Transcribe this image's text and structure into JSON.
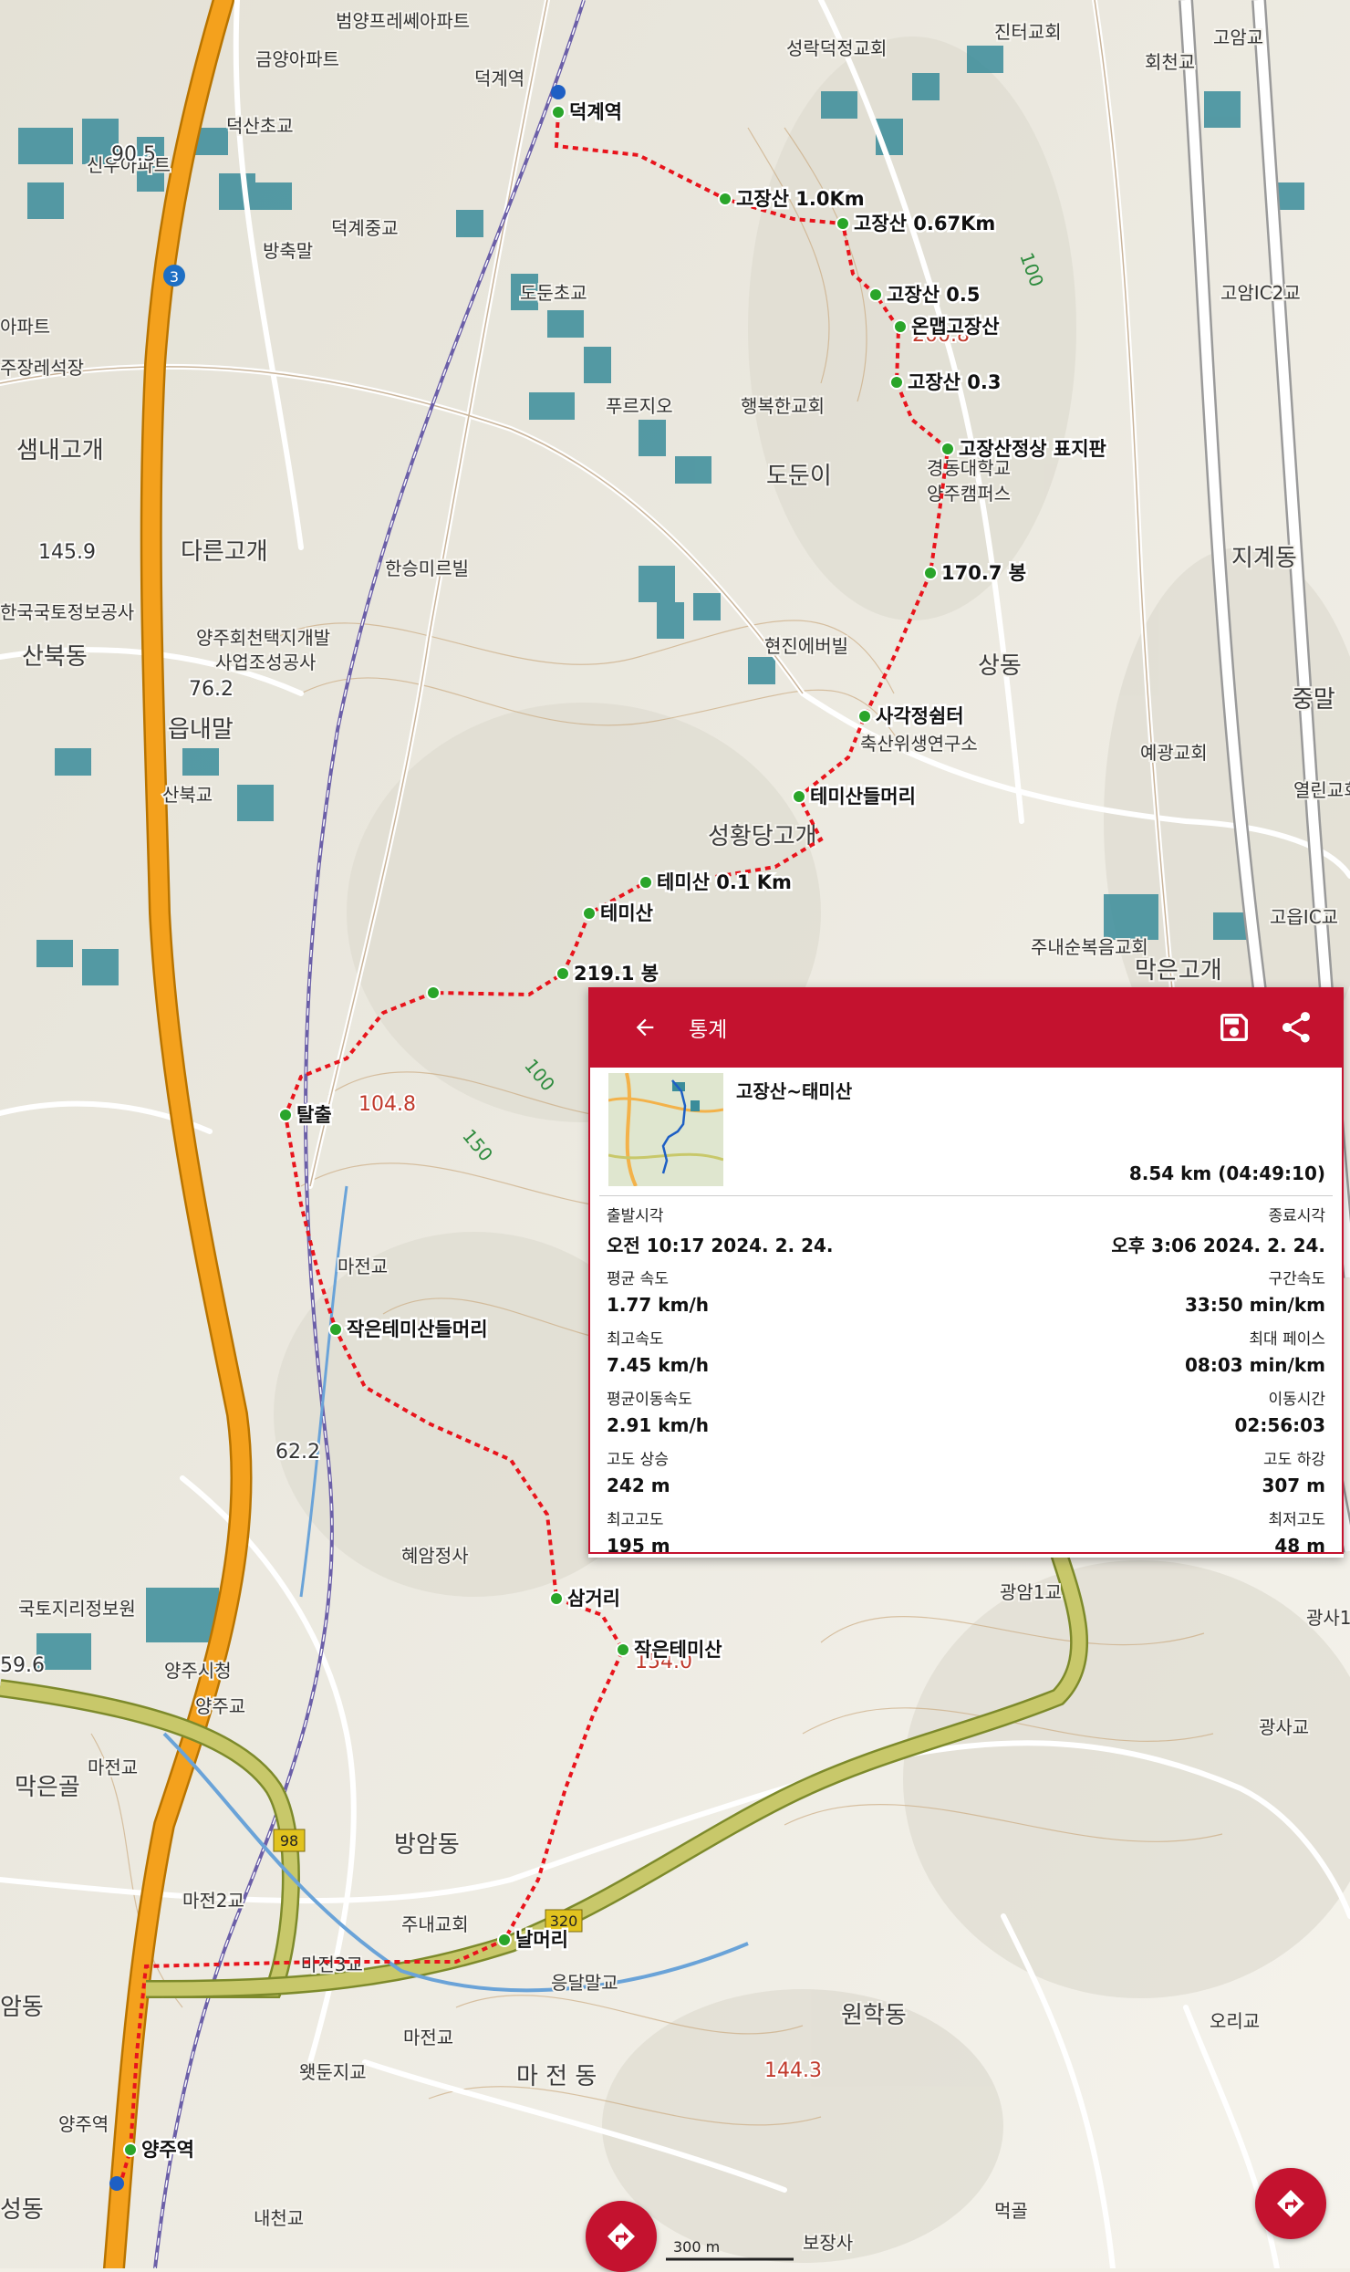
{
  "map": {
    "waypoints": [
      {
        "name": "덕계역"
      },
      {
        "name": "고장산 1.0Km"
      },
      {
        "name": "고장산 0.67Km"
      },
      {
        "name": "고장산 0.5"
      },
      {
        "name": "온맵고장산"
      },
      {
        "name": "고장산 0.3"
      },
      {
        "name": "고장산정상 표지판"
      },
      {
        "name": "170.7 봉"
      },
      {
        "name": "사각정쉼터"
      },
      {
        "name": "테미산들머리"
      },
      {
        "name": "테미산 0.1 Km"
      },
      {
        "name": "테미산"
      },
      {
        "name": "219.1 봉"
      },
      {
        "name": ""
      },
      {
        "name": "탈출"
      },
      {
        "name": "작은테미산들머리"
      },
      {
        "name": "삼거리"
      },
      {
        "name": "작은테미산"
      },
      {
        "name": "날머리"
      },
      {
        "name": "양주역"
      }
    ],
    "places": [
      "범양프레쎄아파트",
      "덕계역",
      "성락덕정교회",
      "진터교회",
      "회천교",
      "고암교",
      "금양아파트",
      "덕산초교",
      "신우아파트",
      "덕계중교",
      "방축말",
      "도둔초교",
      "아파트",
      "주장레석장",
      "샘내고개",
      "다른고개",
      "푸르지오",
      "행복한교회",
      "도둔이",
      "경동대학교",
      "양주캠퍼스",
      "지계동",
      "한승미르빌",
      "한국국토정보공사",
      "양주회천택지개발",
      "사업조성공사",
      "산북동",
      "읍내말",
      "현진에버빌",
      "상동",
      "축산위생연구소",
      "중말",
      "예광교회",
      "산북교",
      "성황당고개",
      "열린교회",
      "고읍IC교",
      "주내순복음교회",
      "막은고개",
      "마전교",
      "혜암정사",
      "국토지리정보원",
      "양주시청",
      "양주교",
      "막은골",
      "마전교",
      "방암동",
      "마전2교",
      "주내교회",
      "마전3교",
      "응달말교",
      "원학동",
      "오리교",
      "암동",
      "마전교",
      "왯둔지교",
      "마 전 동",
      "양주역",
      "성동",
      "내천교",
      "보장사",
      "먹골",
      "광암1교",
      "광사1",
      "광사교",
      "고암IC2교",
      "고읍IC교"
    ],
    "elevations": [
      "200.8",
      "104.8",
      "62.2",
      "76.2",
      "145.9",
      "154.0",
      "144.3",
      "90.5",
      "59.6"
    ],
    "contours": [
      "100",
      "150",
      "100"
    ],
    "road_numbers": [
      "3",
      "98",
      "320"
    ],
    "scale_label": "300 m",
    "route_color": "#e8141c",
    "waypoint_color": "#2aa52a"
  },
  "panel": {
    "title": "통계",
    "track_name": "고장산~태미산",
    "total": "8.54 km (04:49:10)",
    "rows": [
      {
        "left_label": "출발시각",
        "left_value": "오전 10:17 2024. 2. 24.",
        "right_label": "종료시각",
        "right_value": "오후 3:06 2024. 2. 24."
      },
      {
        "left_label": "평균 속도",
        "left_value": "1.77 km/h",
        "right_label": "구간속도",
        "right_value": "33:50 min/km"
      },
      {
        "left_label": "최고속도",
        "left_value": "7.45 km/h",
        "right_label": "최대 페이스",
        "right_value": "08:03 min/km"
      },
      {
        "left_label": "평균이동속도",
        "left_value": "2.91 km/h",
        "right_label": "이동시간",
        "right_value": "02:56:03"
      },
      {
        "left_label": "고도 상승",
        "left_value": "242 m",
        "right_label": "고도 하강",
        "right_value": "307 m"
      },
      {
        "left_label": "최고고도",
        "left_value": "195 m",
        "right_label": "최저고도",
        "right_value": "48 m"
      }
    ]
  },
  "icons": {
    "back": "arrow-left-icon",
    "save": "floppy-disk-icon",
    "share": "share-icon",
    "navigate": "navigate-diamond-icon",
    "layers": "layers-icon"
  },
  "accent_color": "#c4122f"
}
